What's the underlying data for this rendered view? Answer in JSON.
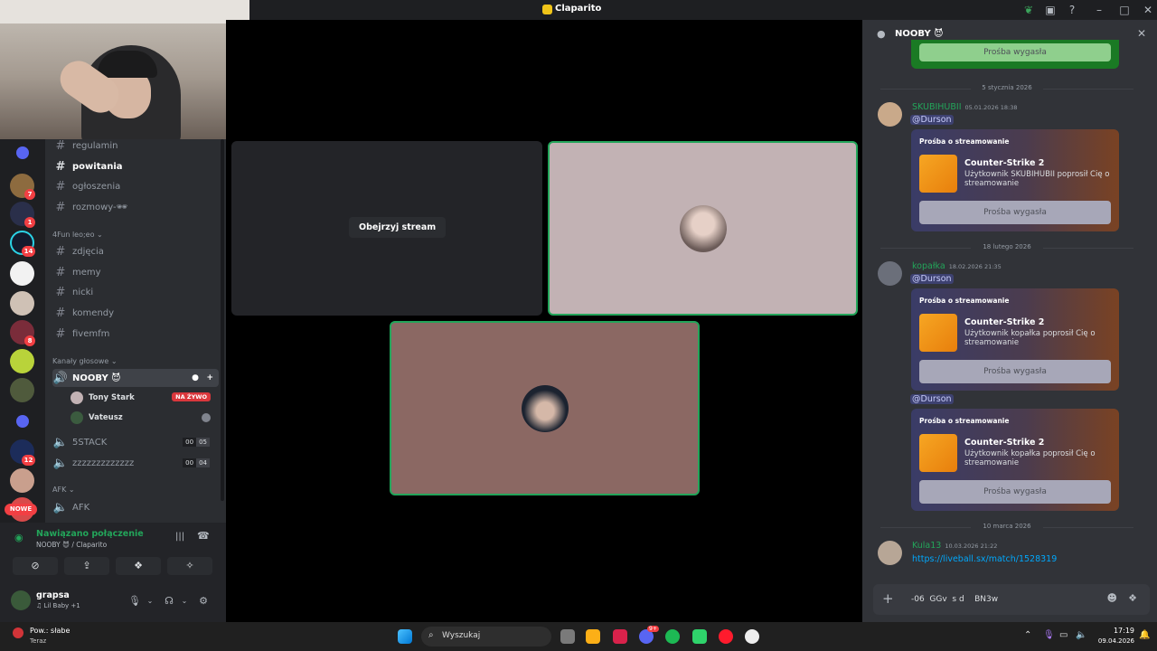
{
  "window": {
    "title": "Claparito"
  },
  "rail": {
    "badges": [
      "7",
      "1",
      "14",
      "8",
      "12"
    ],
    "nowe_label": "NOWE"
  },
  "channels": {
    "text": [
      {
        "label": "regulamin"
      },
      {
        "label": "powitania",
        "active": true
      },
      {
        "label": "ogłoszenia"
      },
      {
        "label": "rozmowy-🕶"
      }
    ],
    "cat_fun": "4Fun leo;eo",
    "fun": [
      {
        "label": "zdjęcia"
      },
      {
        "label": "memy"
      },
      {
        "label": "nicki"
      },
      {
        "label": "komendy"
      },
      {
        "label": "fivemfm"
      }
    ],
    "cat_voice": "Kanały głosowe",
    "voice": {
      "current": "NOOBY 😈",
      "members": [
        {
          "name": "Tony Stark",
          "live": "NA ŻYWO"
        },
        {
          "name": "Vateusz"
        }
      ],
      "others": [
        {
          "label": "5STACK",
          "count": [
            "00",
            "05"
          ]
        },
        {
          "label": "zzzzzzzzzzzzz",
          "count": [
            "00",
            "04"
          ]
        }
      ]
    },
    "cat_afk": "AFK",
    "afk": "AFK"
  },
  "voice_panel": {
    "status": "Nawiązano połączenie",
    "location": "NOOBY 😈 / Claparito"
  },
  "user": {
    "name": "grapsa",
    "status": "♫ Lil Baby +1"
  },
  "stage": {
    "watch_label": "Obejrzyj stream"
  },
  "chat": {
    "header": "NOOBY 😈",
    "top_button": "Prośba wygasła",
    "date1": "5 stycznia 2026",
    "msg1": {
      "author": "SKUBIHUBII",
      "time": "05.01.2026 18:38",
      "mention": "@Durson",
      "card": {
        "label": "Prośba o streamowanie",
        "game": "Counter-Strike 2",
        "desc": "Użytkownik SKUBIHUBII poprosił Cię o streamowanie",
        "button": "Prośba wygasła"
      }
    },
    "date2": "18 lutego 2026",
    "msg2": {
      "author": "kopałka",
      "time": "18.02.2026 21:35",
      "mention": "@Durson",
      "card": {
        "label": "Prośba o streamowanie",
        "game": "Counter-Strike 2",
        "desc": "Użytkownik kopałka poprosił Cię o streamowanie",
        "button": "Prośba wygasła"
      },
      "mention2": "@Durson",
      "card2": {
        "label": "Prośba o streamowanie",
        "game": "Counter-Strike 2",
        "desc": "Użytkownik kopałka poprosił Cię o streamowanie",
        "button": "Prośba wygasła"
      }
    },
    "date3": "10 marca 2026",
    "msg3": {
      "author": "Kula13",
      "time": "10.03.2026 21:22",
      "link": "https://liveball.sx/match/1528319"
    },
    "input_text": "-06  GGv  s d    BN3w"
  },
  "taskbar": {
    "search": "Wyszukaj",
    "weather_title": "Pow.: słabe",
    "weather_sub": "Teraz",
    "time": "17:19",
    "date": "09.04.2026",
    "discord_badge": "9+"
  },
  "colors": {
    "accent_green": "#23a55a",
    "red": "#f23f43",
    "blurple": "#5865f2"
  }
}
